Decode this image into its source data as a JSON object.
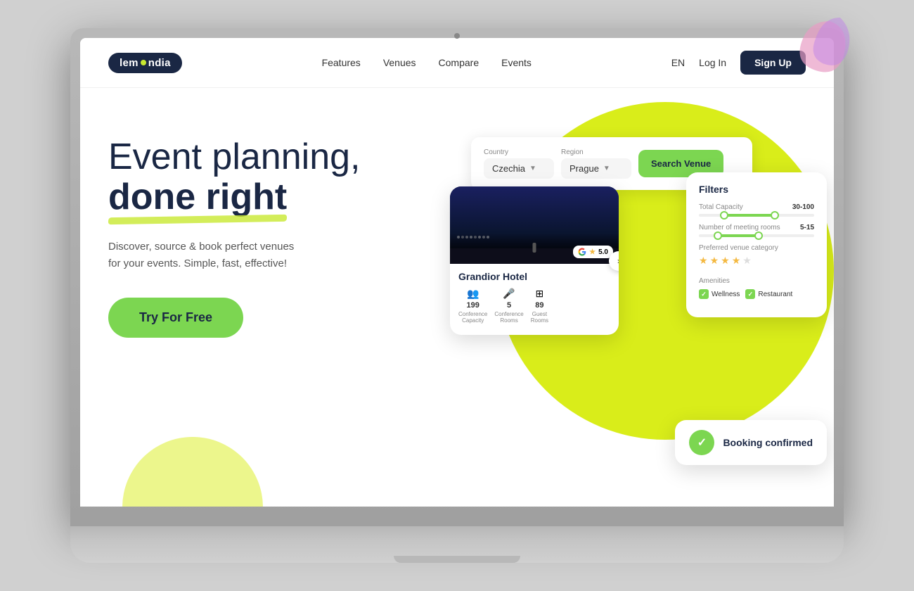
{
  "brand": {
    "name_part1": "lem",
    "name_dot": "●",
    "name_part2": "ndia"
  },
  "navbar": {
    "logo_text": "lemondia",
    "links": [
      "Features",
      "Venues",
      "Compare",
      "Events"
    ],
    "lang": "EN",
    "login_label": "Log In",
    "signup_label": "Sign Up"
  },
  "hero": {
    "title_line1": "Event planning,",
    "title_line2": "done right",
    "subtitle_line1": "Discover, source & book perfect venues",
    "subtitle_line2": "for your events. Simple, fast, effective!",
    "cta_button": "Try For Free"
  },
  "search_widget": {
    "country_label": "Country",
    "country_value": "Czechia",
    "region_label": "Region",
    "region_value": "Prague",
    "search_btn": "Search Venue"
  },
  "venue_card": {
    "name": "Grandior Hotel",
    "google_rating": "5.0",
    "conference_capacity_label": "Conference Capacity",
    "conference_capacity_value": "199",
    "conference_rooms_label": "Conference Rooms",
    "conference_rooms_value": "5",
    "guest_rooms_label": "Guest Rooms",
    "guest_rooms_value": "89"
  },
  "filters_card": {
    "title": "Filters",
    "capacity_label": "Total Capacity",
    "capacity_value": "30-100",
    "capacity_min_pct": 20,
    "capacity_max_pct": 65,
    "rooms_label": "Number of meeting rooms",
    "rooms_value": "5-15",
    "rooms_min_pct": 15,
    "rooms_max_pct": 50,
    "venue_category_label": "Preferred venue category",
    "star_count": 4,
    "star_max": 5,
    "amenities_label": "Amenities",
    "amenity1": "Wellness",
    "amenity2": "Restaurant"
  },
  "booking": {
    "icon": "✓",
    "text": "Booking confirmed"
  }
}
